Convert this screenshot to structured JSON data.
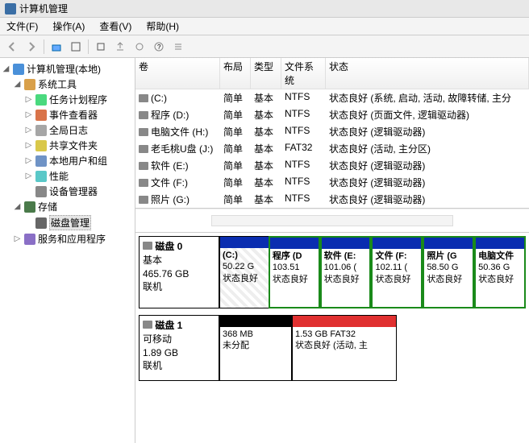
{
  "window": {
    "title": "计算机管理"
  },
  "menu": {
    "file": "文件(F)",
    "action": "操作(A)",
    "view": "查看(V)",
    "help": "帮助(H)"
  },
  "tree": {
    "root": "计算机管理(本地)",
    "sys_tools": "系统工具",
    "task_sched": "任务计划程序",
    "event_viewer": "事件查看器",
    "global_log": "全局日志",
    "shared_folders": "共享文件夹",
    "local_users": "本地用户和组",
    "perf": "性能",
    "device_mgr": "设备管理器",
    "storage": "存储",
    "disk_mgmt": "磁盘管理",
    "services": "服务和应用程序"
  },
  "columns": {
    "vol": "卷",
    "layout": "布局",
    "type": "类型",
    "fs": "文件系统",
    "status": "状态"
  },
  "volumes": [
    {
      "name": "(C:)",
      "layout": "简单",
      "type": "基本",
      "fs": "NTFS",
      "status": "状态良好 (系统, 启动, 活动, 故障转储, 主分"
    },
    {
      "name": "程序 (D:)",
      "layout": "简单",
      "type": "基本",
      "fs": "NTFS",
      "status": "状态良好 (页面文件, 逻辑驱动器)"
    },
    {
      "name": "电脑文件 (H:)",
      "layout": "简单",
      "type": "基本",
      "fs": "NTFS",
      "status": "状态良好 (逻辑驱动器)"
    },
    {
      "name": "老毛桃U盘 (J:)",
      "layout": "简单",
      "type": "基本",
      "fs": "FAT32",
      "status": "状态良好 (活动, 主分区)"
    },
    {
      "name": "软件 (E:)",
      "layout": "简单",
      "type": "基本",
      "fs": "NTFS",
      "status": "状态良好 (逻辑驱动器)"
    },
    {
      "name": "文件 (F:)",
      "layout": "简单",
      "type": "基本",
      "fs": "NTFS",
      "status": "状态良好 (逻辑驱动器)"
    },
    {
      "name": "照片 (G:)",
      "layout": "简单",
      "type": "基本",
      "fs": "NTFS",
      "status": "状态良好 (逻辑驱动器)"
    }
  ],
  "graph": {
    "disk0": {
      "title": "磁盘 0",
      "type": "基本",
      "size": "465.76 GB",
      "status": "联机",
      "parts": [
        {
          "name": "(C:)",
          "size": "50.22 G",
          "status": "状态良好",
          "hatched": true
        },
        {
          "name": "程序 (D",
          "size": "103.51",
          "status": "状态良好"
        },
        {
          "name": "软件 (E:",
          "size": "101.06 (",
          "status": "状态良好"
        },
        {
          "name": "文件 (F:",
          "size": "102.11 (",
          "status": "状态良好"
        },
        {
          "name": "照片 (G",
          "size": "58.50 G",
          "status": "状态良好"
        },
        {
          "name": "电脑文件",
          "size": "50.36 G",
          "status": "状态良好"
        }
      ]
    },
    "disk1": {
      "title": "磁盘 1",
      "type": "可移动",
      "size": "1.89 GB",
      "status": "联机",
      "parts": [
        {
          "name": "",
          "size": "368 MB",
          "status": "未分配",
          "bar": "black"
        },
        {
          "name": "",
          "size": "1.53 GB FAT32",
          "status": "状态良好 (活动, 主",
          "bar": "red"
        }
      ]
    }
  }
}
